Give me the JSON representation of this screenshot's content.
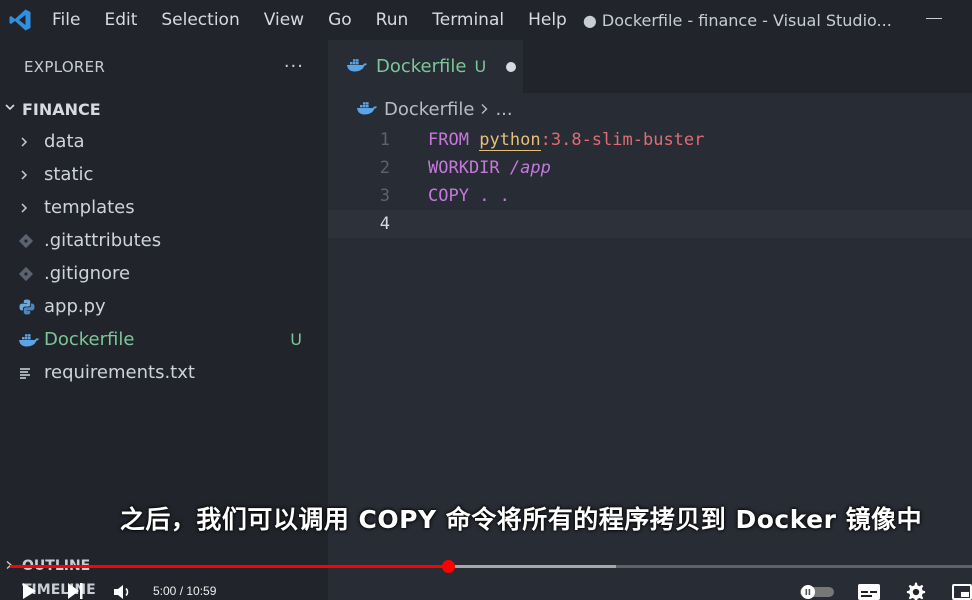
{
  "menu": [
    "File",
    "Edit",
    "Selection",
    "View",
    "Go",
    "Run",
    "Terminal",
    "Help"
  ],
  "window_title": "● Dockerfile - finance - Visual Studio...",
  "explorer": {
    "title": "EXPLORER",
    "more": "···",
    "root": "FINANCE",
    "items": [
      {
        "label": "data",
        "icon": "chevron-right-icon"
      },
      {
        "label": "static",
        "icon": "chevron-right-icon"
      },
      {
        "label": "templates",
        "icon": "chevron-right-icon"
      },
      {
        "label": ".gitattributes",
        "icon": "git-icon"
      },
      {
        "label": ".gitignore",
        "icon": "git-icon"
      },
      {
        "label": "app.py",
        "icon": "python-icon"
      },
      {
        "label": "Dockerfile",
        "icon": "docker-icon",
        "badge": "U",
        "active": true
      },
      {
        "label": "requirements.txt",
        "icon": "text-file-icon"
      }
    ],
    "outline": "OUTLINE",
    "timeline": "TIMELINE"
  },
  "tab": {
    "label": "Dockerfile",
    "status": "U"
  },
  "breadcrumb": {
    "file": "Dockerfile",
    "more": "..."
  },
  "code": {
    "lines": [
      {
        "num": "1",
        "kw": "FROM",
        "image": "python",
        "tag": ":3.8-slim-buster"
      },
      {
        "num": "2",
        "kw": "WORKDIR",
        "arg": "/app"
      },
      {
        "num": "3",
        "kw": "COPY",
        "arg": ". ."
      },
      {
        "num": "4"
      }
    ]
  },
  "subtitle": "之后，我们可以调用 COPY 命令将所有的程序拷贝到 Docker 镜像中",
  "player": {
    "time": "5:00 / 10:59",
    "progress": 0.4551
  },
  "colors": {
    "accent_green": "#7ec699",
    "keyword": "#c678dd",
    "image_name": "#e5c07b",
    "tag": "#e06c75",
    "progress_red": "#ff0000"
  }
}
